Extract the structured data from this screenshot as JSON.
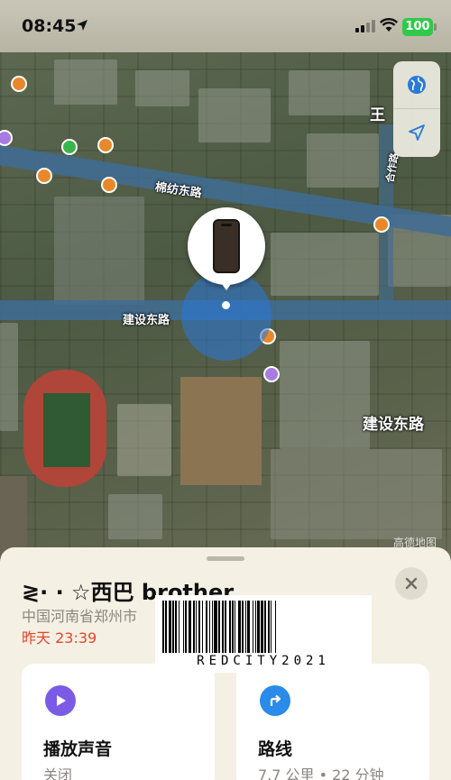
{
  "status_bar": {
    "time": "08:45",
    "battery": "100",
    "battery_color": "#30c94a"
  },
  "map": {
    "road_labels": [
      "棉纺东路",
      "建设东路",
      "建设东路",
      "合作路"
    ],
    "place_label": "王",
    "watermark": "高德地图",
    "controls": {
      "globe_icon": "globe-icon",
      "location_icon": "location-arrow-icon"
    },
    "accent_color": "#2878dc"
  },
  "sheet": {
    "title": "≷· · ☆西巴 brother",
    "address": "中国河南省郑州市",
    "last_seen": "昨天 23:39",
    "close_icon": "close-icon",
    "cards": [
      {
        "label": "播放声音",
        "sub": "关闭",
        "icon": "play-icon",
        "icon_color": "#7b5be6"
      },
      {
        "label": "路线",
        "sub": "7.7 公里 • 22 分钟",
        "icon": "route-arrow-icon",
        "icon_color": "#2a8be8"
      }
    ]
  },
  "barcode": {
    "text": "REDCITY2021"
  }
}
